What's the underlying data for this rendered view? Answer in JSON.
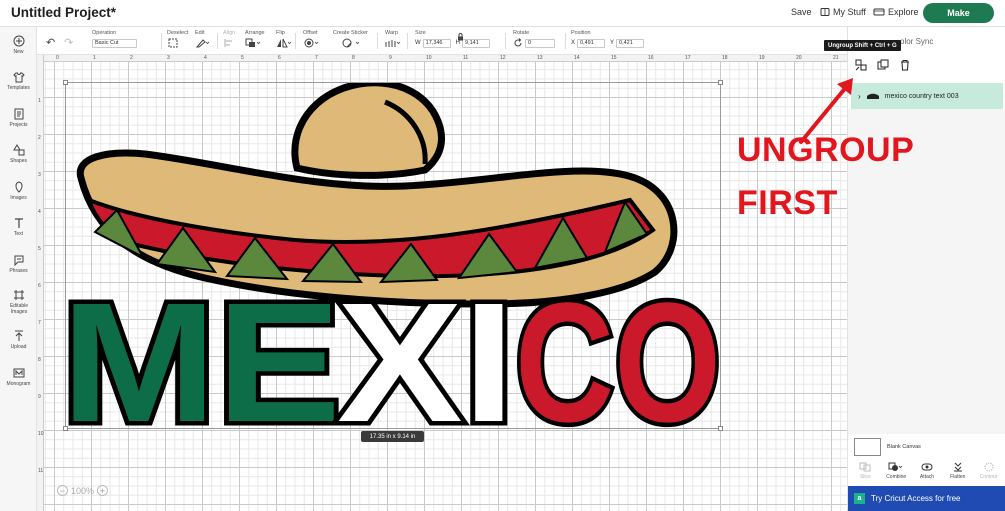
{
  "header": {
    "project_title": "Untitled Project*",
    "save_label": "Save",
    "my_stuff_label": "My Stuff",
    "explore_label": "Explore",
    "make_label": "Make"
  },
  "toolbar": {
    "operation": {
      "label": "Operation",
      "value": "Basic Cut"
    },
    "deselect_label": "Deselect",
    "edit_label": "Edit",
    "align_label": "Align",
    "arrange_label": "Arrange",
    "flip_label": "Flip",
    "offset_label": "Offset",
    "create_sticker_label": "Create Sticker",
    "warp_label": "Warp",
    "size": {
      "label": "Size",
      "w_label": "W",
      "w_value": "17,346",
      "h_label": "H",
      "h_value": "9,141"
    },
    "rotate": {
      "label": "Rotate",
      "value": "0"
    },
    "position": {
      "label": "Position",
      "x_label": "X",
      "x_value": "0,491",
      "y_label": "Y",
      "y_value": "0,421"
    }
  },
  "sidebar": {
    "items": [
      {
        "label": "New",
        "icon": "plus-circle-icon"
      },
      {
        "label": "Templates",
        "icon": "shirt-icon"
      },
      {
        "label": "Projects",
        "icon": "projects-icon"
      },
      {
        "label": "Shapes",
        "icon": "shapes-icon"
      },
      {
        "label": "Images",
        "icon": "images-icon"
      },
      {
        "label": "Text",
        "icon": "text-icon"
      },
      {
        "label": "Phrases",
        "icon": "phrases-icon"
      },
      {
        "label": "Editable Images",
        "icon": "editable-images-icon"
      },
      {
        "label": "Upload",
        "icon": "upload-icon"
      },
      {
        "label": "Monogram",
        "icon": "monogram-icon"
      }
    ]
  },
  "canvas": {
    "ruler_top": [
      "0",
      "1",
      "2",
      "3",
      "4",
      "5",
      "6",
      "7",
      "8",
      "9",
      "10",
      "11",
      "12",
      "13",
      "14",
      "15",
      "16",
      "17",
      "18",
      "19",
      "20",
      "21"
    ],
    "ruler_left": [
      "1",
      "2",
      "3",
      "4",
      "5",
      "6",
      "7",
      "8",
      "9",
      "10",
      "11"
    ],
    "artwork_text": [
      "ME",
      "XI",
      "CO"
    ],
    "size_badge": "17.35  in x 9.14  in",
    "zoom_level": "100%",
    "colors": {
      "hat": "#dfb977",
      "red": "#c9192a",
      "green": "#0d6d48",
      "leaf": "#5b883c",
      "outline": "#000000"
    }
  },
  "right_panel": {
    "tooltip": "Ungroup Shift + Ctrl + G",
    "color_sync_label": "olor Sync",
    "layer_name": "mexico country text 003",
    "blank_canvas_label": "Blank Canvas",
    "bottom_actions": [
      {
        "label": "Slice",
        "enabled": false
      },
      {
        "label": "Combine",
        "enabled": true
      },
      {
        "label": "Attach",
        "enabled": true
      },
      {
        "label": "Flatten",
        "enabled": true
      },
      {
        "label": "Contour",
        "enabled": false
      }
    ],
    "cricut_access_label": "Try Cricut Access for free"
  },
  "annotation": {
    "line1": "UNGROUP",
    "line2": "FIRST",
    "color": "#e2161d"
  }
}
